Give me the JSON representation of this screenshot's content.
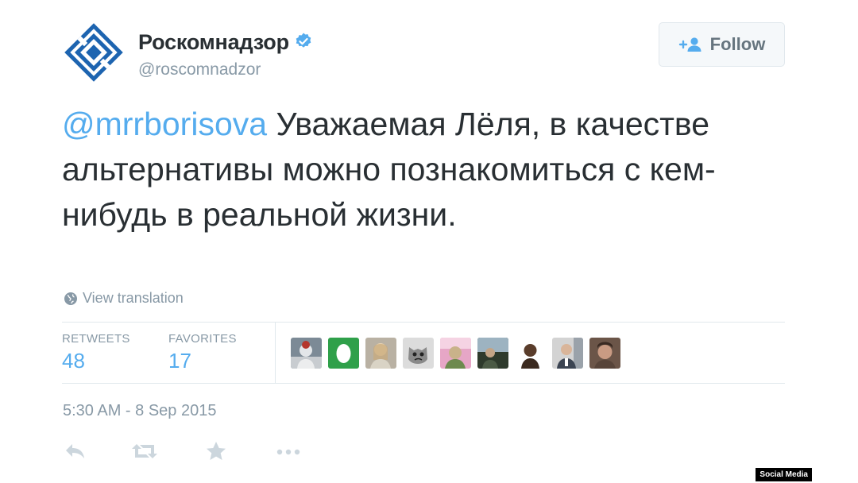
{
  "tweet": {
    "author": {
      "name": "Роскомнадзор",
      "handle": "@roscomnadzor",
      "verified": true
    },
    "follow_label": "Follow",
    "text": {
      "mention": "@mrrborisova",
      "body": " Уважаемая Лёля, в качестве альтернативы можно познакомиться с кем-нибудь в реальной жизни."
    },
    "view_translation": "View translation",
    "stats": [
      {
        "label": "RETWEETS",
        "value": "48"
      },
      {
        "label": "FAVORITES",
        "value": "17"
      }
    ],
    "timestamp": "5:30 AM - 8 Sep 2015"
  },
  "watermark": "Social Media",
  "colors": {
    "accent": "#55acee",
    "muted": "#8899a6",
    "text": "#292f33",
    "border": "#e1e8ed",
    "logo": "#1d64b0"
  },
  "icons": {
    "logo": "roskomnadzor-logo-icon",
    "verified": "verified-badge-icon",
    "follow": "add-user-icon",
    "globe": "globe-icon",
    "reply": "reply-icon",
    "retweet": "retweet-icon",
    "favorite": "star-icon",
    "more": "more-icon"
  }
}
